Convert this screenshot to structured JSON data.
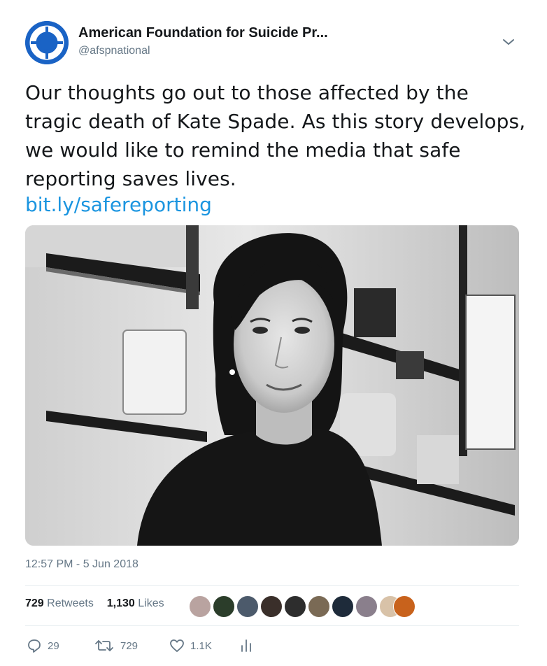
{
  "author": {
    "display_name": "American Foundation for Suicide Pr...",
    "handle": "@afspnational",
    "avatar_icon": "life-ring-icon",
    "avatar_color": "#1a63c5"
  },
  "tweet": {
    "text": "Our thoughts go out to those affected by the tragic death of Kate Spade. As this story develops, we would like to remind the media that safe reporting saves lives.",
    "link_text": "bit.ly/safereporting",
    "link_color": "#1b95e0",
    "timestamp": "12:57 PM - 5 Jun 2018"
  },
  "stats": {
    "retweets_count": "729",
    "retweets_label": "Retweets",
    "likes_count": "1,130",
    "likes_label": "Likes"
  },
  "actions": {
    "reply_icon": "reply-icon",
    "reply_count": "29",
    "retweet_icon": "retweet-icon",
    "retweet_count": "729",
    "like_icon": "heart-icon",
    "like_count": "1.1K",
    "analytics_icon": "analytics-icon"
  },
  "menu": {
    "caret_icon": "chevron-down-icon"
  }
}
